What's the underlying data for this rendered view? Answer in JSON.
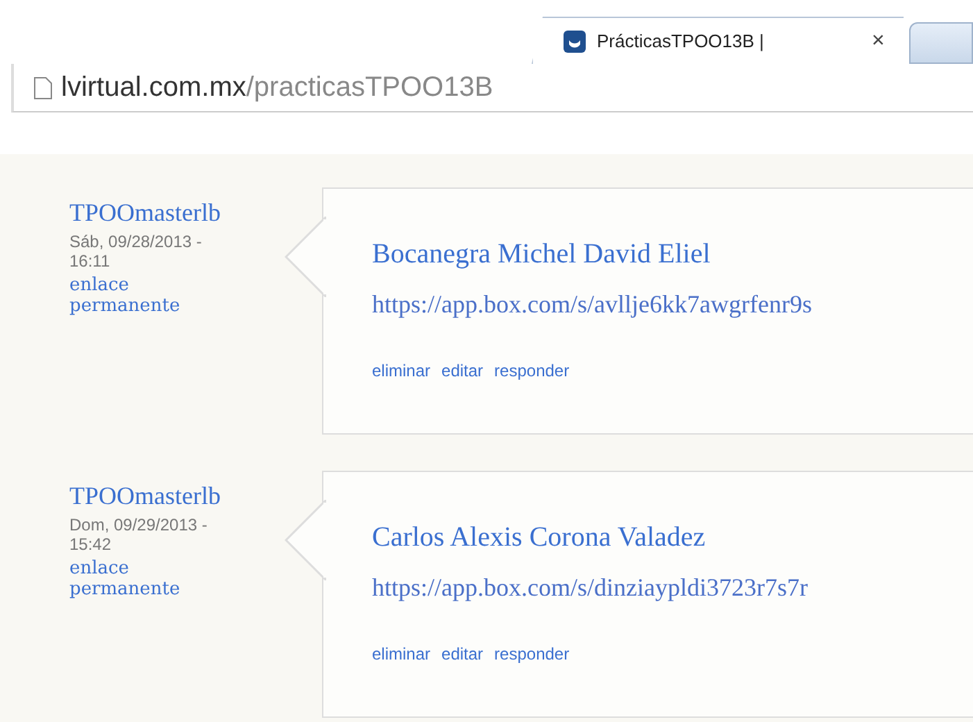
{
  "tab": {
    "title": "PrácticasTPOO13B |",
    "close": "×"
  },
  "address": {
    "host": "lvirtual.com.mx",
    "path": "/practicasTPOO13B"
  },
  "comments": [
    {
      "author": "TPOOmasterlb",
      "date": "Sáb, 09/28/2013 - 16:11",
      "permalink": "enlace permanente",
      "title": "Bocanegra Michel David Eliel",
      "body": "https://app.box.com/s/avllje6kk7awgrfenr9s",
      "actions": [
        "eliminar",
        "editar",
        "responder"
      ]
    },
    {
      "author": "TPOOmasterlb",
      "date": "Dom, 09/29/2013 - 15:42",
      "permalink": "enlace permanente",
      "title": "Carlos Alexis Corona Valadez",
      "body": "https://app.box.com/s/dinziaypldi3723r7s7r",
      "actions": [
        "eliminar",
        "editar",
        "responder"
      ]
    }
  ]
}
